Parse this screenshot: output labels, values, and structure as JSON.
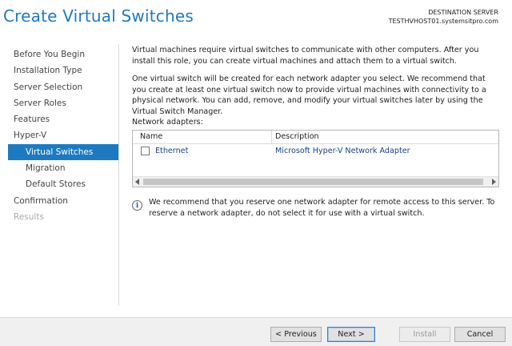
{
  "header": {
    "title": "Create Virtual Switches",
    "dest_label": "DESTINATION SERVER",
    "dest_server": "TESTHVHOST01.systemsitpro.com"
  },
  "nav": {
    "items": [
      {
        "label": "Before You Begin",
        "state": "normal"
      },
      {
        "label": "Installation Type",
        "state": "normal"
      },
      {
        "label": "Server Selection",
        "state": "normal"
      },
      {
        "label": "Server Roles",
        "state": "normal"
      },
      {
        "label": "Features",
        "state": "normal"
      },
      {
        "label": "Hyper-V",
        "state": "normal"
      },
      {
        "label": "Virtual Switches",
        "state": "active"
      },
      {
        "label": "Migration",
        "state": "normal"
      },
      {
        "label": "Default Stores",
        "state": "normal"
      },
      {
        "label": "Confirmation",
        "state": "normal"
      },
      {
        "label": "Results",
        "state": "disabled"
      }
    ]
  },
  "main": {
    "para1": "Virtual machines require virtual switches to communicate with other computers. After you install this role, you can create virtual machines and attach them to a virtual switch.",
    "para2": "One virtual switch will be created for each network adapter you select. We recommend that you create at least one virtual switch now to provide virtual machines with connectivity to a physical network. You can add, remove, and modify your virtual switches later by using the Virtual Switch Manager.",
    "adapters_label": "Network adapters:",
    "table": {
      "headers": [
        "Name",
        "Description"
      ],
      "rows": [
        {
          "name": "Ethernet",
          "description": "Microsoft Hyper-V Network Adapter",
          "checked": false
        }
      ]
    },
    "info_icon": "info-icon",
    "info_text": "We recommend that you reserve one network adapter for remote access to this server. To reserve a network adapter, do not select it for use with a virtual switch."
  },
  "footer": {
    "previous": "< Previous",
    "next": "Next >",
    "install": "Install",
    "cancel": "Cancel"
  },
  "colors": {
    "accent": "#1e7ac0",
    "disabled_text": "#aaaaaa"
  }
}
